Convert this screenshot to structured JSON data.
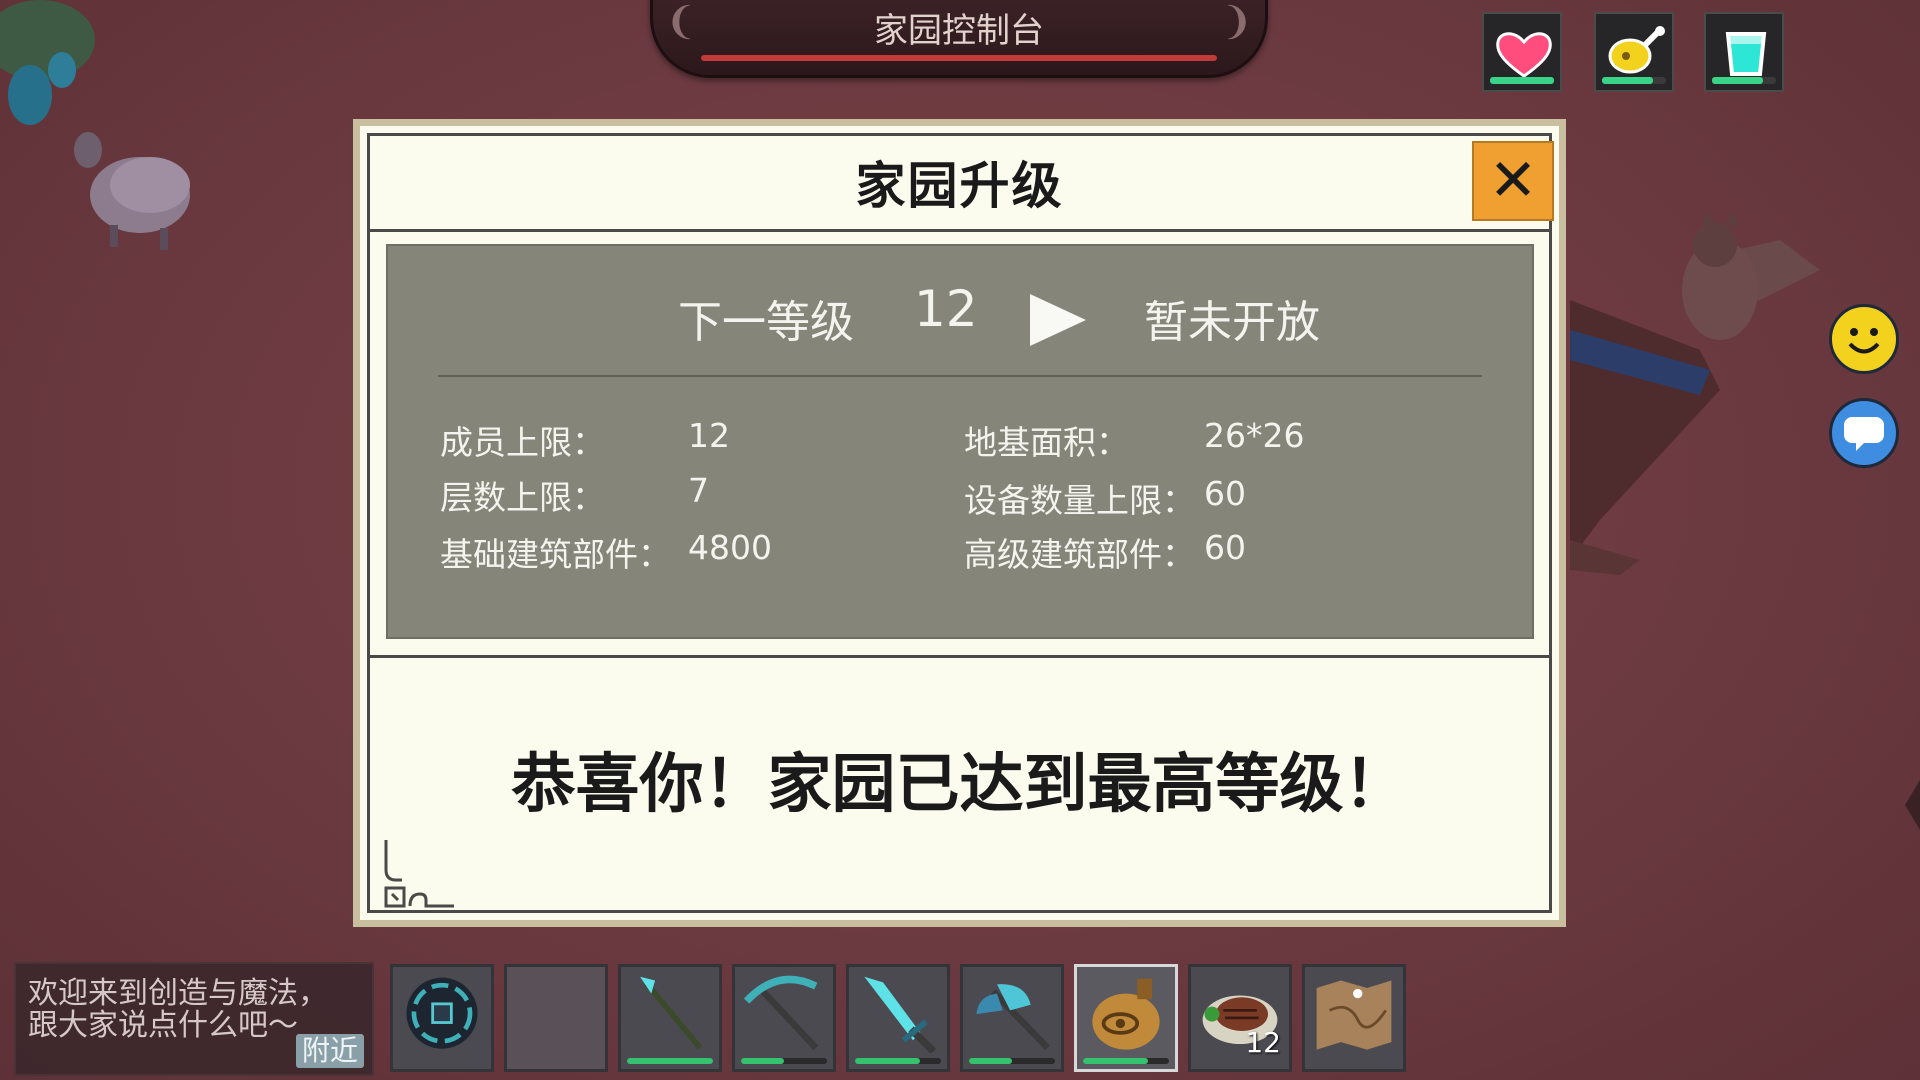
{
  "title_banner": {
    "text": "家园控制台",
    "bar_color": "#c23a3a"
  },
  "status_icons": [
    {
      "name": "health",
      "icon": "heart-icon",
      "color": "#ff4d7d",
      "level": 1.0
    },
    {
      "name": "hunger",
      "icon": "meat-icon",
      "color": "#f2d21d",
      "level": 0.8
    },
    {
      "name": "thirst",
      "icon": "water-cup-icon",
      "color": "#2ee6d6",
      "level": 0.8
    }
  ],
  "side_buttons": [
    {
      "name": "emoji",
      "icon": "smiley-icon"
    },
    {
      "name": "chat",
      "icon": "speech-bubble-icon"
    }
  ],
  "dialog": {
    "title": "家园升级",
    "next_level_label": "下一等级",
    "next_level_value": "12",
    "status": "暂未开放",
    "stats": {
      "member_limit_label": "成员上限：",
      "member_limit_value": "12",
      "foundation_area_label": "地基面积：",
      "foundation_area_value": "26*26",
      "floor_limit_label": "层数上限：",
      "floor_limit_value": "7",
      "device_limit_label": "设备数量上限：",
      "device_limit_value": "60",
      "basic_parts_label": "基础建筑部件：",
      "basic_parts_value": "4800",
      "advanced_parts_label": "高级建筑部件：",
      "advanced_parts_value": "60"
    },
    "message": "恭喜你！家园已达到最高等级！",
    "accent_color": "#f0a030"
  },
  "chat_box": {
    "line1": "欢迎来到创造与魔法，",
    "line2": "跟大家说点什么吧～",
    "channel": "附近"
  },
  "hotbar": [
    {
      "item": "dark-orb",
      "durability": null,
      "count": null
    },
    {
      "item": "empty",
      "durability": null,
      "count": null
    },
    {
      "item": "crystal-staff",
      "durability": 1.0,
      "count": null
    },
    {
      "item": "pickaxe",
      "durability": 0.5,
      "count": null
    },
    {
      "item": "crystal-sword",
      "durability": 0.75,
      "count": null
    },
    {
      "item": "crystal-axe",
      "durability": 0.5,
      "count": null
    },
    {
      "item": "water-flask",
      "durability": 0.75,
      "count": null,
      "selected": true
    },
    {
      "item": "steak",
      "durability": null,
      "count": "12"
    },
    {
      "item": "map",
      "durability": null,
      "count": null
    }
  ]
}
